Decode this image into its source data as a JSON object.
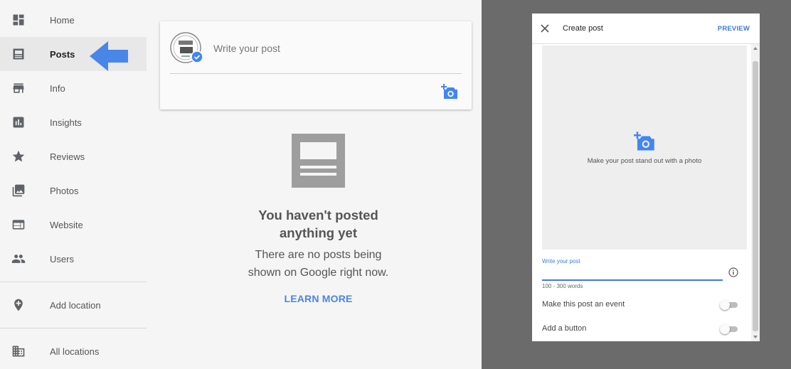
{
  "sidebar": {
    "items": [
      {
        "label": "Home",
        "icon": "dashboard-icon"
      },
      {
        "label": "Posts",
        "icon": "posts-icon"
      },
      {
        "label": "Info",
        "icon": "store-icon"
      },
      {
        "label": "Insights",
        "icon": "insights-icon"
      },
      {
        "label": "Reviews",
        "icon": "star-icon"
      },
      {
        "label": "Photos",
        "icon": "photos-icon"
      },
      {
        "label": "Website",
        "icon": "website-icon"
      },
      {
        "label": "Users",
        "icon": "users-icon"
      },
      {
        "label": "Add location",
        "icon": "add-location-icon"
      },
      {
        "label": "All locations",
        "icon": "building-icon"
      }
    ],
    "active_item": "Posts"
  },
  "composer": {
    "avatar_icon": "verified-business-avatar",
    "placeholder": "Write your post",
    "camera_icon": "add-photo-icon"
  },
  "empty_state": {
    "title_line1": "You haven't posted",
    "title_line2": "anything yet",
    "sub_line1": "There are no posts being",
    "sub_line2": "shown on Google right now.",
    "learn_more": "LEARN MORE"
  },
  "dialog": {
    "title": "Create post",
    "preview": "PREVIEW",
    "photo_text": "Make your post stand out with a photo",
    "field_label": "Write your post",
    "field_value": "",
    "field_help": "100 - 300 words",
    "event_label": "Make this post an event",
    "event_on": false,
    "button_label": "Add a button",
    "button_on": false
  },
  "colors": {
    "accent": "#4285f4",
    "link": "#3d7ae0",
    "overlay": "#6b6b6b",
    "sidebar_bg": "#f5f5f5"
  }
}
